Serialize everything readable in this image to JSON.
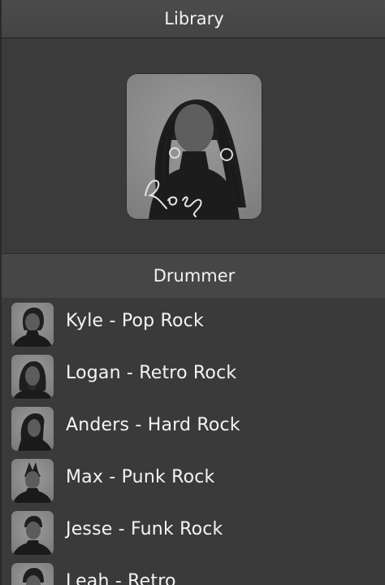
{
  "header": {
    "title": "Library"
  },
  "selected": {
    "name": "Rose",
    "avatar_icon": "rose-portrait-icon"
  },
  "section": {
    "title": "Drummer"
  },
  "drummers": [
    {
      "label": "Kyle - Pop Rock",
      "avatar_icon": "kyle-avatar-icon"
    },
    {
      "label": "Logan - Retro Rock",
      "avatar_icon": "logan-avatar-icon"
    },
    {
      "label": "Anders - Hard Rock",
      "avatar_icon": "anders-avatar-icon"
    },
    {
      "label": "Max - Punk Rock",
      "avatar_icon": "max-avatar-icon"
    },
    {
      "label": "Jesse - Funk Rock",
      "avatar_icon": "jesse-avatar-icon"
    },
    {
      "label": "Leah - Retro",
      "avatar_icon": "drummer-avatar-icon"
    }
  ]
}
